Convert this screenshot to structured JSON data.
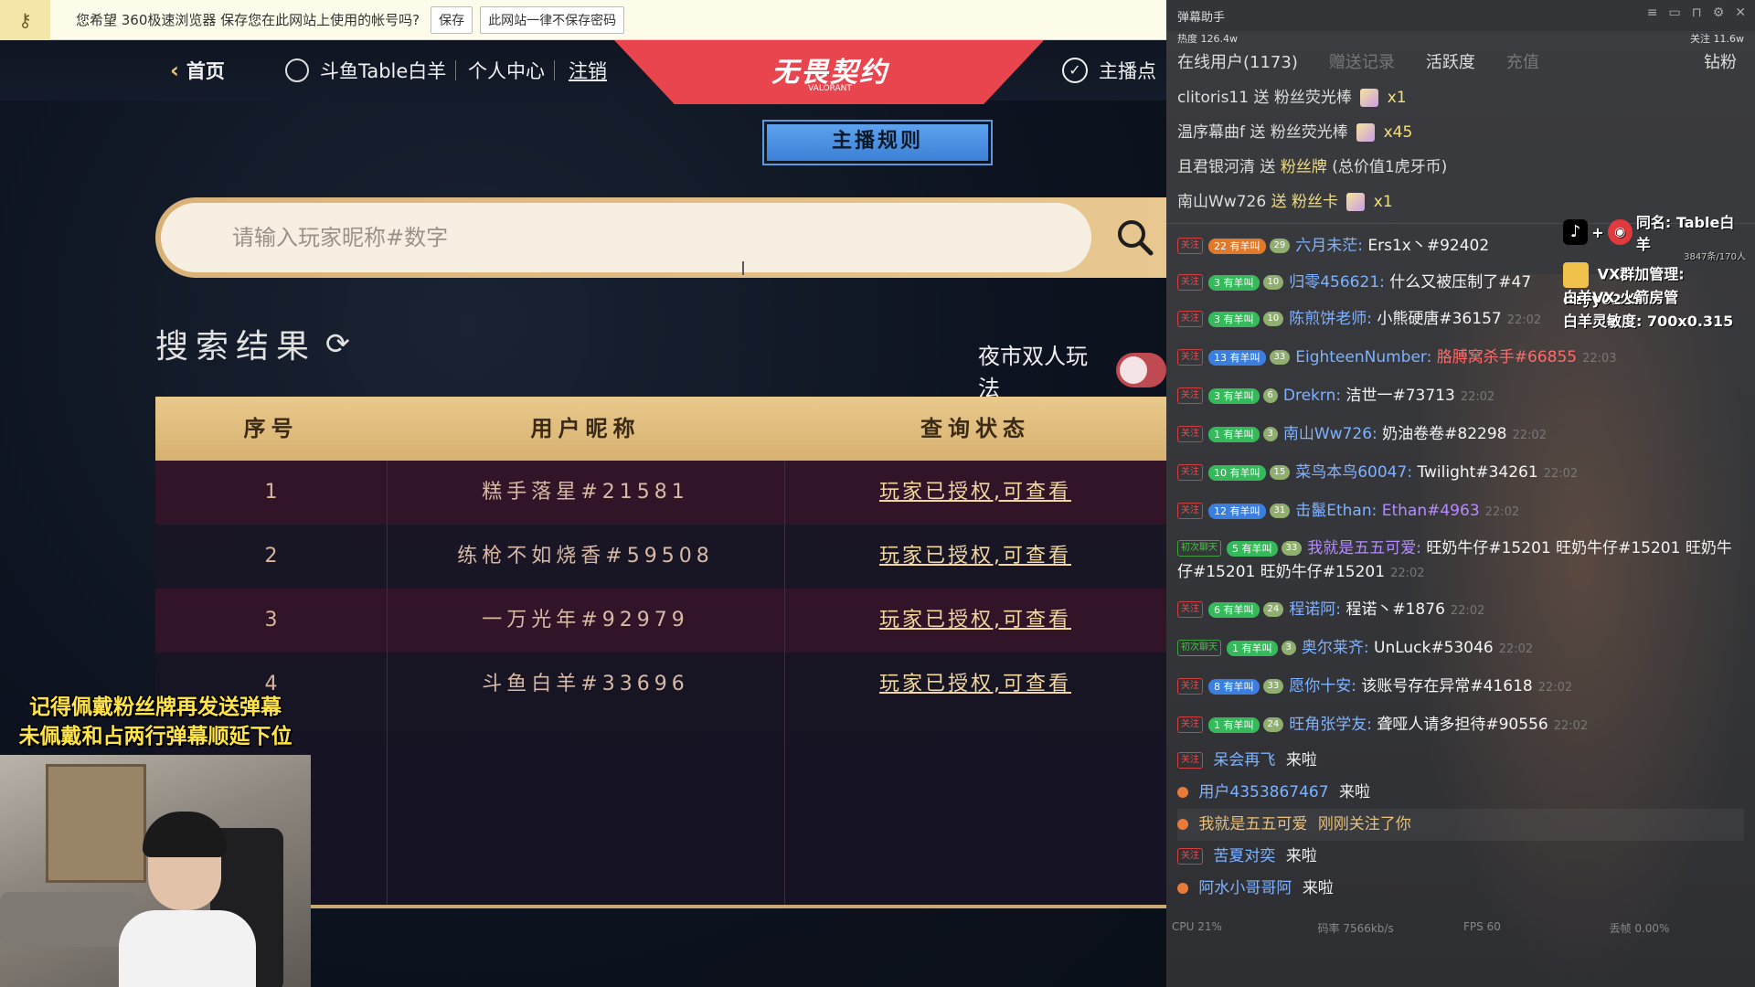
{
  "password_bar": {
    "message": "您希望 360极速浏览器 保存您在此网站上使用的帐号吗?",
    "save_label": "保存",
    "never_label": "此网站一律不保存密码"
  },
  "nav": {
    "home": "首页",
    "username": "斗鱼Table白羊",
    "personal_center": "个人中心",
    "logout": "注销",
    "logo": "无畏契约",
    "logo_sub": "VALORANT",
    "anchor_label": "主播点"
  },
  "rule_button": "主播规则",
  "search": {
    "placeholder": "请输入玩家昵称#数字"
  },
  "results": {
    "title": "搜索结果",
    "night_mode_label": "夜市双人玩法",
    "columns": [
      "序号",
      "用户昵称",
      "查询状态"
    ],
    "rows": [
      {
        "index": "1",
        "nickname": "糕手落星#21581",
        "status": "玩家已授权,可查看"
      },
      {
        "index": "2",
        "nickname": "练枪不如烧香#59508",
        "status": "玩家已授权,可查看"
      },
      {
        "index": "3",
        "nickname": "一万光年#92979",
        "status": "玩家已授权,可查看"
      },
      {
        "index": "4",
        "nickname": "斗鱼白羊#33696",
        "status": "玩家已授权,可查看"
      }
    ]
  },
  "overlay_notice": {
    "line1": "记得佩戴粉丝牌再发送弹幕",
    "line2": "未佩戴和占两行弹幕顺延下位"
  },
  "danmu": {
    "window_title": "弹幕助手",
    "heat": "热度 126.4w",
    "follow": "关注 11.6w",
    "tabs": [
      "在线用户(1173)",
      "赠送记录",
      "活跃度",
      "充值",
      "钻粉"
    ],
    "gifts": [
      {
        "user": "clitoris11",
        "verb": "送",
        "gift": "粉丝荧光棒",
        "qty": "x1"
      },
      {
        "user": "温序幕曲f",
        "verb": "送",
        "gift": "粉丝荧光棒",
        "qty": "x45"
      },
      {
        "user": "且君银河清",
        "verb": "送",
        "gift": "粉丝牌",
        "qty": "(总价值1虎牙币)"
      },
      {
        "user": "南山Ww726",
        "verb": "送",
        "gift": "粉丝卡",
        "qty": "x1"
      }
    ],
    "messages": [
      {
        "tag": "关注",
        "level": "22 有羊叫",
        "fan": "29",
        "user": "六月未茫:",
        "text": "Ers1x丶#92402",
        "time": ""
      },
      {
        "tag": "关注",
        "level": "3 有羊叫",
        "fan": "10",
        "user": "归零456621:",
        "text": "什么又被压制了#47",
        "time": ""
      },
      {
        "tag": "关注",
        "level": "3 有羊叫",
        "fan": "10",
        "user": "陈煎饼老师:",
        "text": "小熊硬唐#36157",
        "time": "22:02"
      },
      {
        "tag": "关注",
        "level": "13 有羊叫",
        "fan": "33",
        "user": "EighteenNumber:",
        "text": "胳膊窝杀手#66855",
        "time": "22:03"
      },
      {
        "tag": "关注",
        "level": "3 有羊叫",
        "fan": "6",
        "user": "Drekrn:",
        "text": "洁世一#73713",
        "time": "22:02"
      },
      {
        "tag": "关注",
        "level": "1 有羊叫",
        "fan": "3",
        "user": "南山Ww726:",
        "text": "奶油卷卷#82298",
        "time": "22:02"
      },
      {
        "tag": "关注",
        "level": "10 有羊叫",
        "fan": "15",
        "user": "菜鸟本鸟60047:",
        "text": "Twilight#34261",
        "time": "22:02"
      },
      {
        "tag": "关注",
        "level": "12 有羊叫",
        "fan": "31",
        "user": "击鬣Ethan:",
        "text": "Ethan#4963",
        "time": "22:02"
      },
      {
        "tag": "初次聊天",
        "level": "5 有羊叫",
        "fan": "33",
        "user": "我就是五五可爱:",
        "text": "旺奶牛仔#15201 旺奶牛仔#15201 旺奶牛仔#15201 旺奶牛仔#15201",
        "time": "22:02"
      },
      {
        "tag": "关注",
        "level": "6 有羊叫",
        "fan": "24",
        "user": "程诺阿:",
        "text": "程诺丶#1876",
        "time": "22:02"
      },
      {
        "tag": "初次聊天",
        "level": "1 有羊叫",
        "fan": "3",
        "user": "奥尔莱齐:",
        "text": "UnLuck#53046",
        "time": "22:02"
      },
      {
        "tag": "关注",
        "level": "8 有羊叫",
        "fan": "33",
        "user": "愿你十安:",
        "text": "该账号存在异常#41618",
        "time": "22:02"
      },
      {
        "tag": "关注",
        "level": "1 有羊叫",
        "fan": "24",
        "user": "旺角张学友:",
        "text": "聋哑人请多担待#90556",
        "time": "22:02"
      }
    ],
    "entries": [
      {
        "user": "呆会再飞",
        "action": "来啦"
      },
      {
        "user": "用户4353867467",
        "action": "来啦"
      },
      {
        "user": "我就是五五可爱",
        "action": "刚刚关注了你"
      },
      {
        "user": "苦夏对奕",
        "action": "来啦"
      },
      {
        "user": "阿水小哥哥阿",
        "action": "来啦"
      }
    ],
    "footer": [
      "CPU 21%",
      "码率 7566kb/s",
      "FPS 60",
      "丢帧 0.00%"
    ],
    "side": {
      "same_name": "同名: Table白羊",
      "viewers": "3847条/170人",
      "vx_group": "VX群加管理: dzyy0225",
      "vx_room": "白羊VX 火箭房管",
      "sensitivity": "白羊灵敏度: 700x0.315"
    }
  }
}
